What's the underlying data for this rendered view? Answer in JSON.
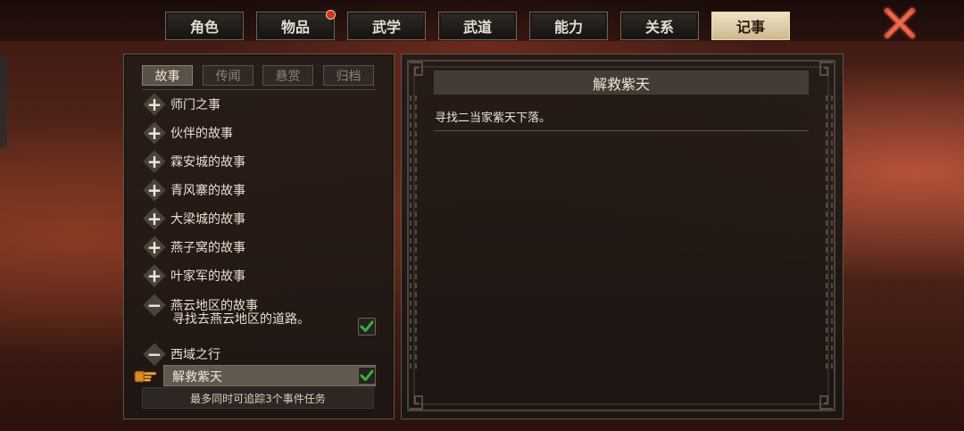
{
  "tabs": [
    {
      "label": "角色",
      "active": false,
      "badge": false
    },
    {
      "label": "物品",
      "active": false,
      "badge": true
    },
    {
      "label": "武学",
      "active": false,
      "badge": false
    },
    {
      "label": "武道",
      "active": false,
      "badge": false
    },
    {
      "label": "能力",
      "active": false,
      "badge": false
    },
    {
      "label": "关系",
      "active": false,
      "badge": false
    },
    {
      "label": "记事",
      "active": true,
      "badge": false
    }
  ],
  "close_icon": "close-x-icon",
  "left_panel": {
    "subtabs": [
      {
        "label": "故事",
        "active": true
      },
      {
        "label": "传闻",
        "active": false
      },
      {
        "label": "悬赏",
        "active": false
      },
      {
        "label": "归档",
        "active": false
      }
    ],
    "categories": [
      {
        "label": "师门之事",
        "expanded": false
      },
      {
        "label": "伙伴的故事",
        "expanded": false
      },
      {
        "label": "霖安城的故事",
        "expanded": false
      },
      {
        "label": "青风寨的故事",
        "expanded": false
      },
      {
        "label": "大梁城的故事",
        "expanded": false
      },
      {
        "label": "燕子窝的故事",
        "expanded": false
      },
      {
        "label": "叶家军的故事",
        "expanded": false
      },
      {
        "label": "燕云地区的故事",
        "expanded": true
      },
      {
        "label": "西域之行",
        "expanded": true
      }
    ],
    "quests": [
      {
        "label": "寻找去燕云地区的道路。",
        "tracked": true,
        "selected": false
      },
      {
        "label": "解救紫天",
        "tracked": true,
        "selected": true
      }
    ],
    "footer": "最多同时可追踪3个事件任务"
  },
  "detail": {
    "title": "解救紫天",
    "description": "寻找二当家紫天下落。"
  },
  "colors": {
    "accent": "#cdb98f",
    "panel": "#261c18",
    "check": "#3fae3a"
  }
}
